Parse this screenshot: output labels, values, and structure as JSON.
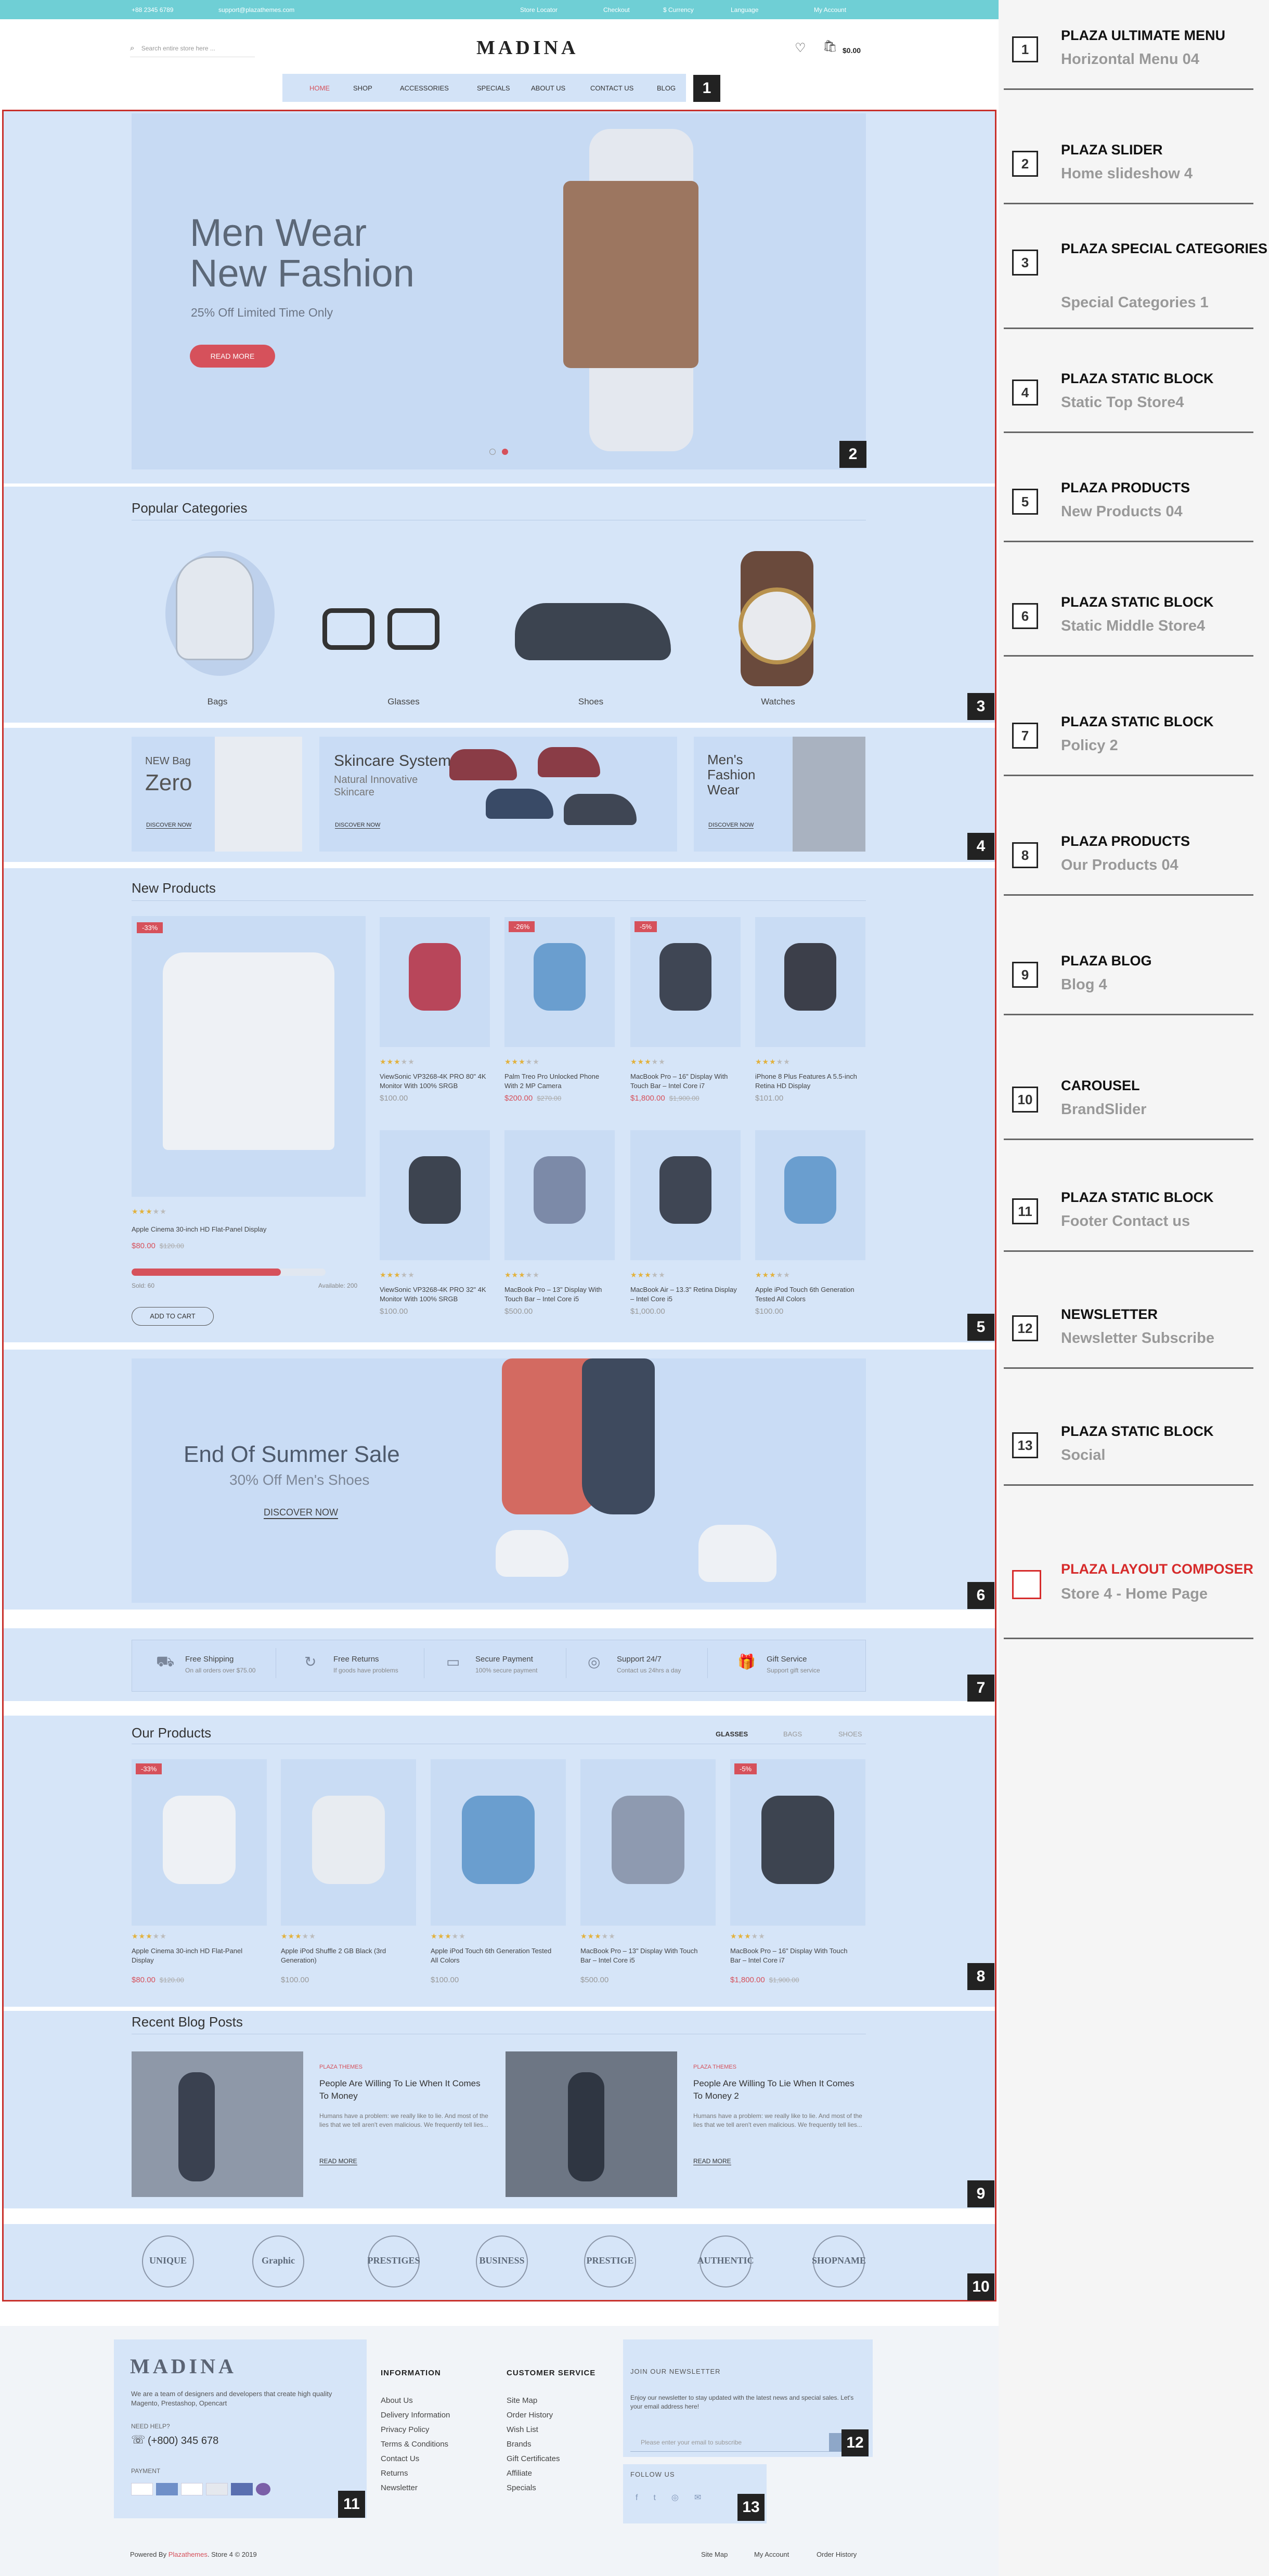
{
  "topbar": {
    "phone": "+88 2345 6789",
    "email": "support@plazathemes.com",
    "store_locator": "Store Locator",
    "checkout": "Checkout",
    "currency": "$ Currency",
    "language": "Language",
    "account": "My Account"
  },
  "header": {
    "logo": "MADINA",
    "search_placeholder": "Search entire store here ...",
    "cart_total": "$0.00"
  },
  "nav": {
    "items": [
      "HOME",
      "SHOP",
      "ACCESSORIES",
      "SPECIALS",
      "ABOUT US",
      "CONTACT US",
      "BLOG"
    ]
  },
  "slider": {
    "title_line1": "Men Wear",
    "title_line2": "New Fashion",
    "subtitle": "25% Off Limited Time Only",
    "button": "READ MORE"
  },
  "categories": {
    "title": "Popular Categories",
    "items": [
      "Bags",
      "Glasses",
      "Shoes",
      "Watches"
    ]
  },
  "static_top": {
    "b1_small": "NEW Bag",
    "b1_big": "Zero",
    "b1_btn": "DISCOVER NOW",
    "b2_title": "Skincare System",
    "b2_sub1": "Natural Innovative",
    "b2_sub2": "Skincare",
    "b2_btn": "DISCOVER NOW",
    "b3_l1": "Men's",
    "b3_l2": "Fashion",
    "b3_l3": "Wear",
    "b3_btn": "DISCOVER NOW"
  },
  "new_products": {
    "title": "New Products",
    "featured": {
      "sale": "-33%",
      "name": "Apple Cinema 30-inch HD Flat-Panel Display",
      "price": "$80.00",
      "old": "$120.00",
      "sold": "Sold: 60",
      "available": "Available: 200",
      "sold_fraction": 0.77,
      "button": "ADD TO CART"
    },
    "items": [
      {
        "name": "ViewSonic VP3268-4K PRO 80\" 4K Monitor With 100% SRGB",
        "price": "$100.00",
        "old": "",
        "sale": ""
      },
      {
        "name": "Palm Treo Pro Unlocked Phone With 2 MP Camera",
        "price": "$200.00",
        "old": "$270.00",
        "sale": "-26%"
      },
      {
        "name": "MacBook Pro – 16\" Display With Touch Bar – Intel Core i7",
        "price": "$1,800.00",
        "old": "$1,900.00",
        "sale": "-5%"
      },
      {
        "name": "iPhone 8 Plus Features A 5.5-inch Retina HD Display",
        "price": "$101.00",
        "old": "",
        "sale": ""
      },
      {
        "name": "ViewSonic VP3268-4K PRO 32\" 4K Monitor With 100% SRGB",
        "price": "$100.00",
        "old": "",
        "sale": ""
      },
      {
        "name": "MacBook Pro – 13\" Display With Touch Bar – Intel Core i5",
        "price": "$500.00",
        "old": "",
        "sale": ""
      },
      {
        "name": "MacBook Air – 13.3\" Retina Display – Intel Core i5",
        "price": "$1,000.00",
        "old": "",
        "sale": ""
      },
      {
        "name": "Apple iPod Touch 6th Generation Tested All Colors",
        "price": "$100.00",
        "old": "",
        "sale": ""
      }
    ]
  },
  "summer": {
    "title": "End Of Summer Sale",
    "subtitle": "30% Off Men's Shoes",
    "button": "DISCOVER NOW"
  },
  "policy": [
    {
      "title": "Free Shipping",
      "sub": "On all orders over $75.00"
    },
    {
      "title": "Free Returns",
      "sub": "If goods have problems"
    },
    {
      "title": "Secure Payment",
      "sub": "100% secure payment"
    },
    {
      "title": "Support 24/7",
      "sub": "Contact us 24hrs a day"
    },
    {
      "title": "Gift Service",
      "sub": "Support gift service"
    }
  ],
  "our_products": {
    "title": "Our Products",
    "tabs": [
      "GLASSES",
      "BAGS",
      "SHOES"
    ],
    "items": [
      {
        "name": "Apple Cinema 30-inch HD Flat-Panel Display",
        "price": "$80.00",
        "old": "$120.00",
        "sale": "-33%"
      },
      {
        "name": "Apple iPod Shuffle 2 GB Black (3rd Generation)",
        "price": "$100.00",
        "old": "",
        "sale": ""
      },
      {
        "name": "Apple iPod Touch 6th Generation Tested All Colors",
        "price": "$100.00",
        "old": "",
        "sale": ""
      },
      {
        "name": "MacBook Pro – 13\" Display With Touch Bar – Intel Core i5",
        "price": "$500.00",
        "old": "",
        "sale": ""
      },
      {
        "name": "MacBook Pro – 16\" Display With Touch Bar – Intel Core i7",
        "price": "$1,800.00",
        "old": "$1,900.00",
        "sale": "-5%"
      }
    ]
  },
  "blog": {
    "title": "Recent Blog Posts",
    "posts": [
      {
        "tag": "PLAZA THEMES",
        "title": "People Are Willing To Lie When It Comes To Money",
        "excerpt": "Humans have a problem: we really like to lie. And most of the lies that we tell aren't even malicious. We frequently tell lies...",
        "more": "READ MORE"
      },
      {
        "tag": "PLAZA THEMES",
        "title": "People Are Willing To Lie When It Comes To Money 2",
        "excerpt": "Humans have a problem: we really like to lie. And most of the lies that we tell aren't even malicious. We frequently tell lies...",
        "more": "READ MORE"
      }
    ]
  },
  "brands": [
    "UNIQUE",
    "Graphic",
    "PRESTIGES",
    "BUSINESS",
    "PRESTIGE",
    "AUTHENTIC",
    "SHOPNAME"
  ],
  "footer": {
    "logo": "MADINA",
    "about": "We are a team of designers and developers that create high quality Magento, Prestashop, Opencart",
    "need_help": "NEED HELP?",
    "phone": "(+800) 345 678",
    "payment": "PAYMENT",
    "info_title": "INFORMATION",
    "info": [
      "About Us",
      "Delivery Information",
      "Privacy Policy",
      "Terms & Conditions",
      "Contact Us",
      "Returns",
      "Newsletter"
    ],
    "cs_title": "CUSTOMER SERVICE",
    "cs": [
      "Site Map",
      "Order History",
      "Wish List",
      "Brands",
      "Gift Certificates",
      "Affiliate",
      "Specials"
    ],
    "nl_title": "JOIN OUR NEWSLETTER",
    "nl_text": "Enjoy our newsletter to stay updated with the latest news and special sales. Let's your email address here!",
    "nl_placeholder": "Please enter your email to subscribe",
    "follow": "FOLLOW US",
    "powered_prefix": "Powered By ",
    "powered_brand": "Plazathemes",
    "powered_suffix": ". Store 4 © 2019",
    "bottom_links": [
      "Site Map",
      "My Account",
      "Order History"
    ]
  },
  "labels": [
    "1",
    "2",
    "3",
    "4",
    "5",
    "6",
    "7",
    "8",
    "9",
    "10",
    "11",
    "12",
    "13"
  ],
  "panel": [
    {
      "num": "1",
      "title": "PLAZA ULTIMATE MENU",
      "sub": "Horizontal Menu 04"
    },
    {
      "num": "2",
      "title": "PLAZA SLIDER",
      "sub": "Home slideshow 4"
    },
    {
      "num": "3",
      "title": "PLAZA SPECIAL CATEGORIES",
      "sub": "Special Categories 1"
    },
    {
      "num": "4",
      "title": "PLAZA STATIC BLOCK",
      "sub": "Static Top Store4"
    },
    {
      "num": "5",
      "title": "PLAZA PRODUCTS",
      "sub": "New Products 04"
    },
    {
      "num": "6",
      "title": "PLAZA STATIC BLOCK",
      "sub": "Static Middle Store4"
    },
    {
      "num": "7",
      "title": "PLAZA STATIC BLOCK",
      "sub": "Policy 2"
    },
    {
      "num": "8",
      "title": "PLAZA PRODUCTS",
      "sub": "Our Products 04"
    },
    {
      "num": "9",
      "title": "PLAZA BLOG",
      "sub": "Blog 4"
    },
    {
      "num": "10",
      "title": "CAROUSEL",
      "sub": "BrandSlider"
    },
    {
      "num": "11",
      "title": "PLAZA STATIC BLOCK",
      "sub": "Footer Contact us"
    },
    {
      "num": "12",
      "title": "NEWSLETTER",
      "sub": "Newsletter Subscribe"
    },
    {
      "num": "13",
      "title": "PLAZA STATIC BLOCK",
      "sub": "Social"
    }
  ],
  "layout_composer": {
    "title": "PLAZA LAYOUT COMPOSER",
    "sub": "Store 4 - Home Page"
  },
  "colors": {
    "accent": "#d6515b",
    "topbar": "#6fcfd5",
    "highlight": "#d6e5f8",
    "frame": "#c8302b"
  }
}
